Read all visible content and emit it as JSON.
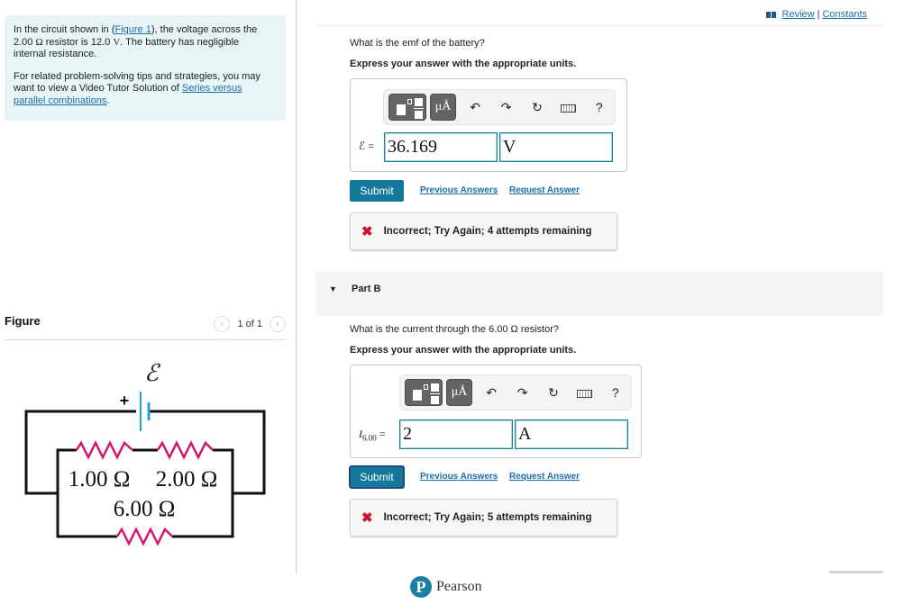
{
  "intro": {
    "p1_before_link": "In the circuit shown in (",
    "figure_link": "Figure 1",
    "p1_after_link": "), the voltage across the",
    "p1_line2_value": "2.00",
    "omega": "Ω",
    "p1_line2_rest": " resistor is 12.0 ",
    "volt_unit": "V",
    "p1_line2_end": ". The battery has negligible",
    "p1_line3": "internal resistance.",
    "p2_text": "For related problem-solving tips and strategies, you may want to view a Video Tutor Solution of ",
    "p2_link": "Series versus parallel combinations",
    "p2_end": "."
  },
  "figure": {
    "title": "Figure",
    "pager_text": "1 of 1",
    "prev_icon": "‹",
    "next_icon": "›",
    "circuit": {
      "emf_symbol": "ℰ",
      "plus_sign": "+",
      "r1_label": "1.00 Ω",
      "r2_label": "2.00 Ω",
      "r3_label": "6.00 Ω",
      "colors": {
        "wire": "#111111",
        "resistor": "#d4146f",
        "battery": "#1ba4dc"
      }
    }
  },
  "header": {
    "review_label": "Review",
    "separator": "|",
    "constants_label": "Constants"
  },
  "part_a": {
    "question": "What is the emf of the battery?",
    "instruction": "Express your answer with the appropriate units.",
    "toolbar": {
      "units_label": "μÅ",
      "help_label": "?",
      "undo": "↶",
      "redo": "↷",
      "reset": "↻"
    },
    "input_label": "ℰ =",
    "value": "36.169",
    "unit": "V",
    "submit_label": "Submit",
    "previous_answers_label": "Previous Answers",
    "request_answer_label": "Request Answer",
    "feedback_icon": "✖",
    "feedback_text": "Incorrect; Try Again; 4 attempts remaining"
  },
  "part_b": {
    "title": "Part B",
    "question": "What is the current through the 6.00 Ω resistor?",
    "instruction": "Express your answer with the appropriate units.",
    "toolbar": {
      "units_label": "μÅ",
      "help_label": "?",
      "undo": "↶",
      "redo": "↷",
      "reset": "↻"
    },
    "input_label_main": "I",
    "input_label_sub": "6.00",
    "input_label_eq": " =",
    "value": "2",
    "unit": "A",
    "submit_label": "Submit",
    "previous_answers_label": "Previous Answers",
    "request_answer_label": "Request Answer",
    "feedback_icon": "✖",
    "feedback_text": "Incorrect; Try Again; 5 attempts remaining"
  },
  "footer": {
    "brand_initial": "P",
    "brand_name": "Pearson"
  }
}
